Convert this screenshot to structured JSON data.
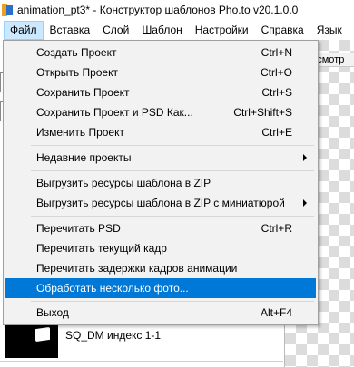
{
  "window": {
    "title": "animation_pt3* - Конструктор шаблонов Pho.to v20.1.0.0"
  },
  "menubar": {
    "items": [
      {
        "label": "Файл",
        "active": true
      },
      {
        "label": "Вставка"
      },
      {
        "label": "Слой"
      },
      {
        "label": "Шаблон"
      },
      {
        "label": "Настройки"
      },
      {
        "label": "Справка"
      },
      {
        "label": "Язык"
      }
    ]
  },
  "background": {
    "tab_label": "росмотр",
    "layer_label": "SQ_DM индекс 1-1"
  },
  "file_menu": {
    "items": [
      {
        "label": "Создать Проект",
        "shortcut": "Ctrl+N"
      },
      {
        "label": "Открыть Проект",
        "shortcut": "Ctrl+O"
      },
      {
        "label": "Сохранить Проект",
        "shortcut": "Ctrl+S"
      },
      {
        "label": "Сохранить Проект и PSD Как...",
        "shortcut": "Ctrl+Shift+S"
      },
      {
        "label": "Изменить Проект",
        "shortcut": "Ctrl+E"
      },
      {
        "label": "Недавние проекты",
        "submenu": true
      },
      {
        "label": "Выгрузить ресурсы шаблона в ZIP"
      },
      {
        "label": "Выгрузить ресурсы шаблона в ZIP с миниатюрой",
        "submenu": true
      },
      {
        "label": "Перечитать PSD",
        "shortcut": "Ctrl+R"
      },
      {
        "label": "Перечитать текущий кадр"
      },
      {
        "label": "Перечитать задержки кадров анимации"
      },
      {
        "label": "Обработать несколько фото...",
        "highlighted": true
      },
      {
        "label": "Выход",
        "shortcut": "Alt+F4"
      }
    ]
  },
  "colors": {
    "highlight": "#0078d7",
    "menubar_active": "#cce8ff",
    "menu_background": "#f2f2f2"
  }
}
